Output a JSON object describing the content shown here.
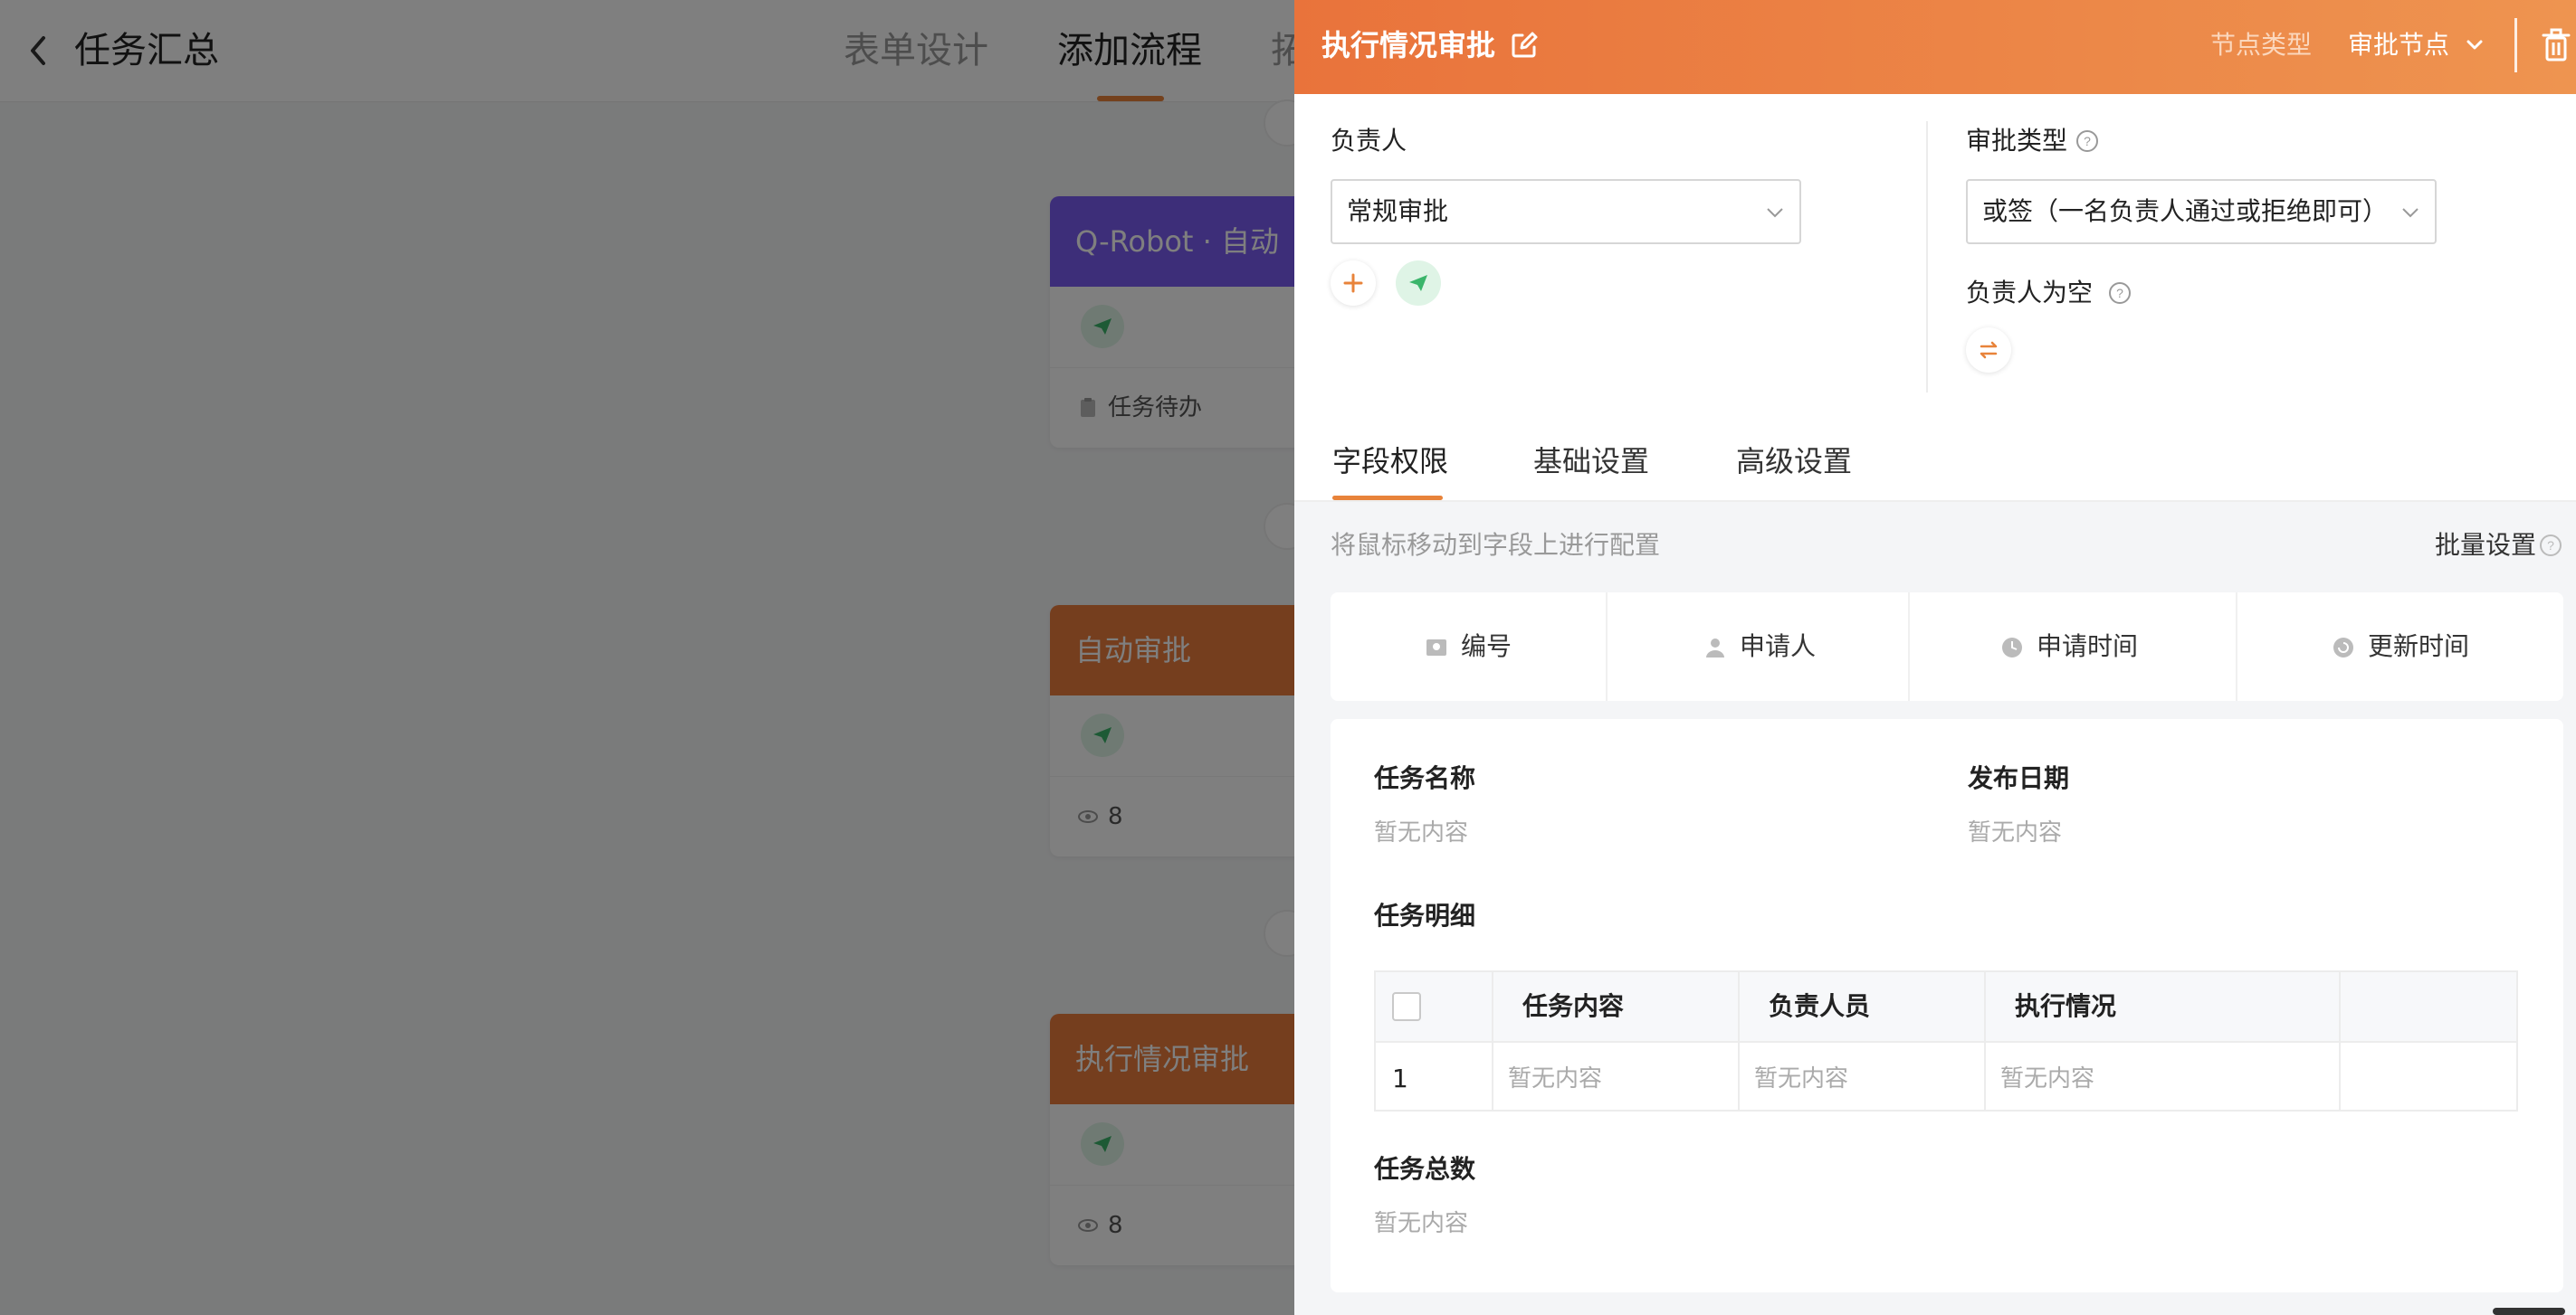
{
  "page": {
    "back_icon": "chevron-left-icon",
    "title": "任务汇总",
    "tabs": [
      {
        "label": "表单设计",
        "active": false
      },
      {
        "label": "添加流程",
        "active": true
      },
      {
        "label": "拓",
        "active": false
      }
    ]
  },
  "flow": {
    "cards": [
      {
        "title": "Q-Robot · 自动",
        "color": "#7a5df3",
        "icon": "send-icon",
        "footer_icon": "clipboard-icon",
        "footer": "任务待办"
      },
      {
        "title": "自动审批",
        "color": "#ea7c3c",
        "icon": "send-icon",
        "footer_icon": "eye-icon",
        "footer": "8"
      },
      {
        "title": "执行情况审批",
        "color": "#ea7c3c",
        "icon": "send-icon",
        "footer_icon": "eye-icon",
        "footer": "8"
      }
    ]
  },
  "drawer": {
    "title": "执行情况审批",
    "node_type_label": "节点类型",
    "node_type_value": "审批节点",
    "colors": {
      "accent": "#e8833a",
      "header_start": "#e9733b",
      "header_end": "#ee9450",
      "send_green": "#3bb56b"
    },
    "assignee": {
      "label": "负责人",
      "value": "常规审批",
      "add_icon": "plus-icon",
      "send_icon": "send-icon"
    },
    "approval_type": {
      "label": "审批类型",
      "value": "或签（一名负责人通过或拒绝即可）",
      "help_icon": "question-circle-icon"
    },
    "empty_assignee": {
      "label": "负责人为空",
      "help_icon": "question-circle-icon",
      "action_icon": "swap-icon"
    },
    "tabs": [
      {
        "label": "字段权限",
        "active": true
      },
      {
        "label": "基础设置",
        "active": false
      },
      {
        "label": "高级设置",
        "active": false
      }
    ],
    "hint": "将鼠标移动到字段上进行配置",
    "batch_label": "批量设置",
    "system_fields": [
      {
        "label": "编号",
        "icon": "id-card-icon"
      },
      {
        "label": "申请人",
        "icon": "user-icon"
      },
      {
        "label": "申请时间",
        "icon": "clock-icon"
      },
      {
        "label": "更新时间",
        "icon": "refresh-clock-icon"
      }
    ],
    "form": {
      "task_name": {
        "label": "任务名称",
        "value": "暂无内容"
      },
      "publish_date": {
        "label": "发布日期",
        "value": "暂无内容"
      },
      "detail_label": "任务明细",
      "detail_table": {
        "headers": [
          "任务内容",
          "负责人员",
          "执行情况"
        ],
        "rows": [
          {
            "index": "1",
            "cells": [
              "暂无内容",
              "暂无内容",
              "暂无内容"
            ]
          }
        ]
      },
      "task_total": {
        "label": "任务总数",
        "value": "暂无内容"
      }
    }
  }
}
